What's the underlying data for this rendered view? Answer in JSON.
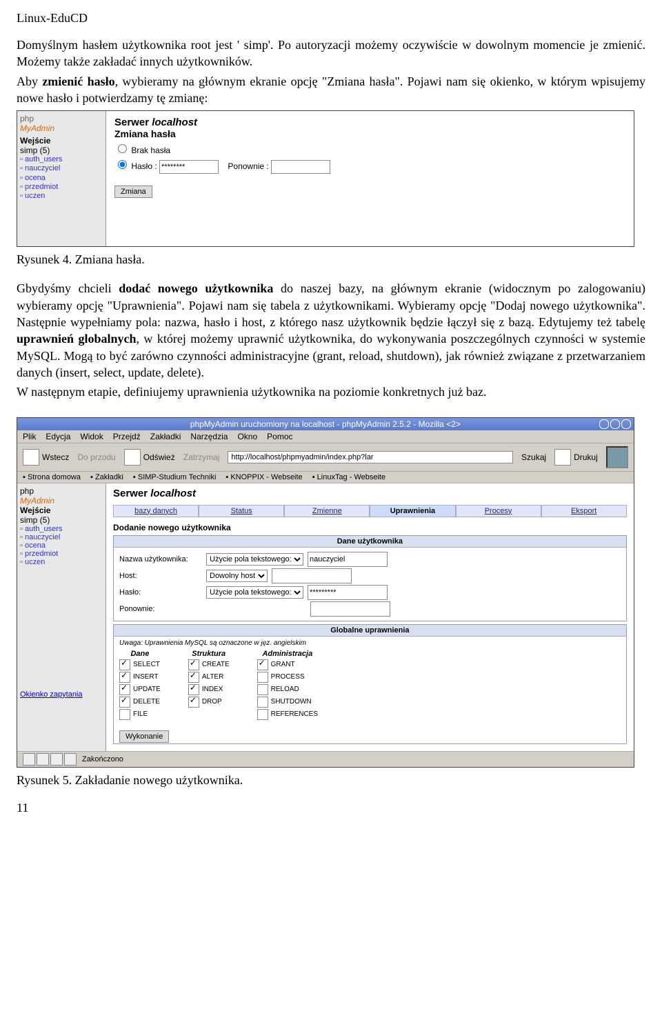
{
  "doc": {
    "header": "Linux-EduCD",
    "p1_a": "Domyślnym hasłem użytkownika root jest ' simp'. Po autoryzacji możemy oczywiście w dowolnym momencie je zmienić. Możemy także zakładać innych użytkowników.",
    "p1_b1": "Aby ",
    "p1_b2": "zmienić hasło",
    "p1_b3": ", wybieramy na głównym ekranie opcję \"Zmiana hasła\". Pojawi nam się okienko, w którym wpisujemy nowe hasło i potwierdzamy tę zmianę:",
    "fig1": "Rysunek 4. Zmiana hasła.",
    "p2_a": "Gbydyśmy chcieli ",
    "p2_b": "dodać nowego użytkownika",
    "p2_c": " do naszej bazy, na głównym ekranie (widocznym po zalogowaniu) wybieramy opcję \"Uprawnienia\". Pojawi nam się tabela z użytkownikami. Wybieramy opcję \"Dodaj nowego użytkownika\". Następnie wypełniamy pola: nazwa, hasło i host, z którego nasz użytkownik będzie łączył się z bazą. Edytujemy też tabelę ",
    "p2_d": "uprawnień globalnych",
    "p2_e": ", w której możemy uprawnić użytkownika, do wykonywania poszczególnych czynności w systemie MySQL. Mogą to być zarówno czynności administracyjne (grant, reload, shutdown), jak również związane z przetwarzaniem danych (insert, select, update, delete).",
    "p2_f": "W następnym etapie, definiujemy uprawnienia użytkownika na poziomie konkretnych już baz.",
    "fig2": "Rysunek 5. Zakładanie nowego użytkownika.",
    "pagenum": "11"
  },
  "shot1": {
    "sidebar": {
      "logo_php": "php",
      "logo_my": "MyAdmin",
      "wej": "Wejście",
      "simp": "simp (5)",
      "items": [
        "auth_users",
        "nauczyciel",
        "ocena",
        "przedmiot",
        "uczen"
      ]
    },
    "main": {
      "server_lbl": "Serwer ",
      "server_val": "localhost",
      "heading": "Zmiana hasła",
      "radio_none": "Brak hasła",
      "radio_pwd": "Hasło :",
      "pwd_val": "********",
      "retype_lbl": "Ponownie :",
      "submit": "Zmiana"
    }
  },
  "shot2": {
    "title": "phpMyAdmin uruchomiony na localhost - phpMyAdmin 2.5.2 - Mozilla <2>",
    "menu": [
      "Plik",
      "Edycja",
      "Widok",
      "Przejdź",
      "Zakładki",
      "Narzędzia",
      "Okno",
      "Pomoc"
    ],
    "tools": {
      "back": "Wstecz",
      "fwd": "Do przodu",
      "reload": "Odśwież",
      "stop": "Zatrzymaj",
      "print": "Drukuj",
      "search": "Szukaj"
    },
    "addr": "http://localhost/phpmyadmin/index.php?lar",
    "bookmarks": [
      "Strona domowa",
      "Zakładki",
      "SIMP-Studium Techniki",
      "KNOPPIX - Webseite",
      "LinuxTag - Webseite"
    ],
    "sidebar": {
      "logo_php": "php",
      "logo_my": "MyAdmin",
      "wej": "Wejście",
      "simp": "simp (5)",
      "items": [
        "auth_users",
        "nauczyciel",
        "ocena",
        "przedmiot",
        "uczen"
      ],
      "query": "Okienko zapytania"
    },
    "main": {
      "server_lbl": "Serwer ",
      "server_val": "localhost",
      "tabs": [
        "bazy danych",
        "Status",
        "Zmienne",
        "Uprawnienia",
        "Procesy",
        "Eksport"
      ],
      "add_user": "Dodanie nowego użytkownika",
      "sect_data": "Dane użytkownika",
      "rows": {
        "name_lbl": "Nazwa użytkownika:",
        "name_sel": "Użycie pola tekstowego:",
        "name_val": "nauczyciel",
        "host_lbl": "Host:",
        "host_sel": "Dowolny host",
        "pwd_lbl": "Hasło:",
        "pwd_sel": "Użycie pola tekstowego:",
        "pwd_val": "*********",
        "re_lbl": "Ponownie:"
      },
      "sect_priv": "Globalne uprawnienia",
      "note": "Uwaga: Uprawnienia MySQL są oznaczone w jęz. angielskim",
      "cols": {
        "dane": "Dane",
        "struktura": "Struktura",
        "admin": "Administracja"
      },
      "privs": {
        "dane": [
          {
            "label": "SELECT",
            "checked": true
          },
          {
            "label": "INSERT",
            "checked": true
          },
          {
            "label": "UPDATE",
            "checked": true
          },
          {
            "label": "DELETE",
            "checked": true
          },
          {
            "label": "FILE",
            "checked": false
          }
        ],
        "struktura": [
          {
            "label": "CREATE",
            "checked": true
          },
          {
            "label": "ALTER",
            "checked": true
          },
          {
            "label": "INDEX",
            "checked": true
          },
          {
            "label": "DROP",
            "checked": true
          }
        ],
        "admin": [
          {
            "label": "GRANT",
            "checked": true
          },
          {
            "label": "PROCESS",
            "checked": false
          },
          {
            "label": "RELOAD",
            "checked": false
          },
          {
            "label": "SHUTDOWN",
            "checked": false
          },
          {
            "label": "REFERENCES",
            "checked": false
          }
        ]
      },
      "submit": "Wykonanie"
    },
    "status": "Zakończono"
  }
}
